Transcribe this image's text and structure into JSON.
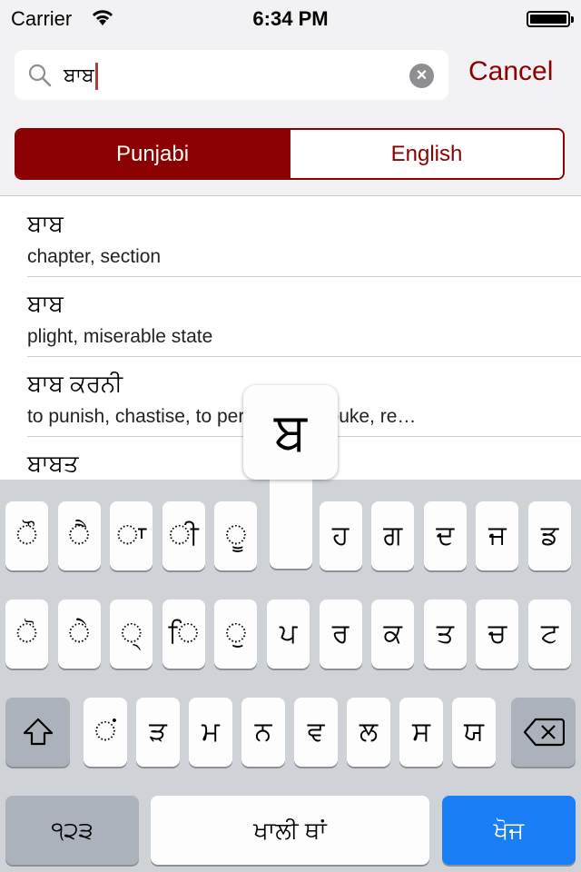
{
  "status": {
    "carrier": "Carrier",
    "time": "6:34 PM",
    "battery_level": 1.0
  },
  "search": {
    "value": "ਬਾਬ",
    "cancel": "Cancel",
    "icon": "search-icon",
    "clear_icon": "clear-icon"
  },
  "segment": {
    "options": [
      "Punjabi",
      "English"
    ],
    "selected": "Punjabi",
    "accent": "#8b0000"
  },
  "results": [
    {
      "punjabi": "ਬਾਬ",
      "english": "chapter, section"
    },
    {
      "punjabi": "ਬਾਬ",
      "english": "plight, miserable state"
    },
    {
      "punjabi": "ਬਾਬ ਕਰਨੀ",
      "english": "to punish, chastise, to persecute, rebuke, re…"
    },
    {
      "punjabi": "ਬਾਬਤ",
      "english": ""
    }
  ],
  "keyboard": {
    "row1": [
      "◌ੌ",
      "◌ੈ",
      "◌ਾ",
      "◌ੀ",
      "◌ੂ",
      "ਬ",
      "ਹ",
      "ਗ",
      "ਦ",
      "ਜ",
      "ਡ"
    ],
    "row2": [
      "◌ੋ",
      "◌ੇ",
      "◌੍",
      "◌ਿ",
      "◌ੁ",
      "ਪ",
      "ਰ",
      "ਕ",
      "ਤ",
      "ਚ",
      "ਟ"
    ],
    "row3": [
      "◌ਂ",
      "ੜ",
      "ਮ",
      "ਨ",
      "ਵ",
      "ਲ",
      "ਸ",
      "ਯ"
    ],
    "popup": "ਬ",
    "numbers": "੧੨੩",
    "space": "ਖਾਲੀ ਥਾਂ",
    "search": "ਖੋਜ",
    "shift_icon": "shift-icon",
    "delete_icon": "backspace-icon",
    "search_color": "#1a7ef7"
  }
}
